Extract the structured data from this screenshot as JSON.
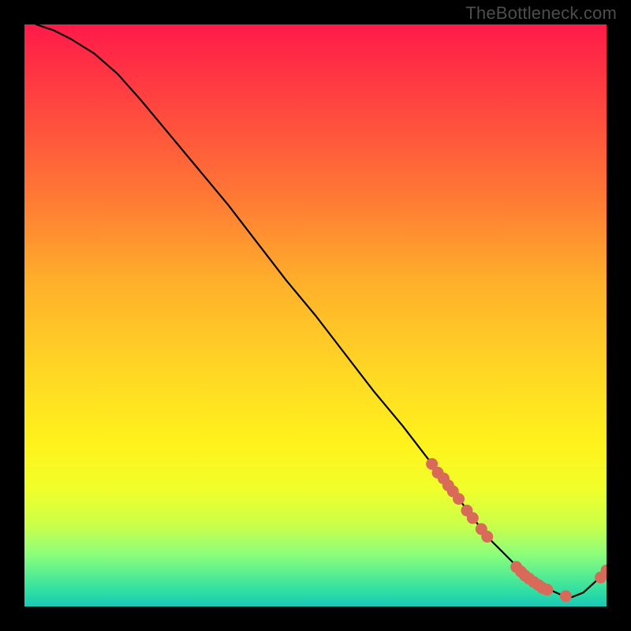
{
  "watermark": "TheBottleneck.com",
  "chart_data": {
    "type": "line",
    "title": "",
    "xlabel": "",
    "ylabel": "",
    "xlim": [
      0,
      100
    ],
    "ylim": [
      0,
      100
    ],
    "grid": false,
    "series": [
      {
        "name": "curve",
        "color": "#000000",
        "x": [
          2,
          5,
          8,
          12,
          16,
          20,
          25,
          30,
          35,
          40,
          45,
          50,
          55,
          60,
          65,
          70,
          75,
          78,
          80,
          82,
          84,
          86,
          88,
          90,
          92,
          94,
          96,
          98,
          100
        ],
        "y": [
          100,
          99,
          97.5,
          95,
          91.5,
          87,
          81,
          75,
          69,
          62.5,
          56,
          50,
          43.5,
          37,
          31,
          24.5,
          18,
          14,
          11.5,
          9.5,
          7.5,
          5.8,
          4.2,
          3.0,
          2.1,
          1.6,
          2.4,
          4.2,
          6.2
        ]
      },
      {
        "name": "points",
        "color": "#d96a59",
        "type": "scatter-cluster",
        "points": [
          {
            "x": 70.0,
            "y": 24.5
          },
          {
            "x": 71.0,
            "y": 23.0
          },
          {
            "x": 72.0,
            "y": 22.0
          },
          {
            "x": 72.8,
            "y": 20.8
          },
          {
            "x": 73.6,
            "y": 19.8
          },
          {
            "x": 74.6,
            "y": 18.5
          },
          {
            "x": 76.0,
            "y": 16.5
          },
          {
            "x": 77.0,
            "y": 15.2
          },
          {
            "x": 78.5,
            "y": 13.3
          },
          {
            "x": 79.5,
            "y": 12.0
          },
          {
            "x": 84.5,
            "y": 6.8
          },
          {
            "x": 85.3,
            "y": 6.0
          },
          {
            "x": 86.0,
            "y": 5.3
          },
          {
            "x": 86.7,
            "y": 4.8
          },
          {
            "x": 87.5,
            "y": 4.2
          },
          {
            "x": 88.3,
            "y": 3.7
          },
          {
            "x": 89.0,
            "y": 3.2
          },
          {
            "x": 89.8,
            "y": 2.9
          },
          {
            "x": 93.0,
            "y": 1.8
          },
          {
            "x": 99.0,
            "y": 5.0
          },
          {
            "x": 100.0,
            "y": 6.2
          }
        ]
      }
    ]
  }
}
